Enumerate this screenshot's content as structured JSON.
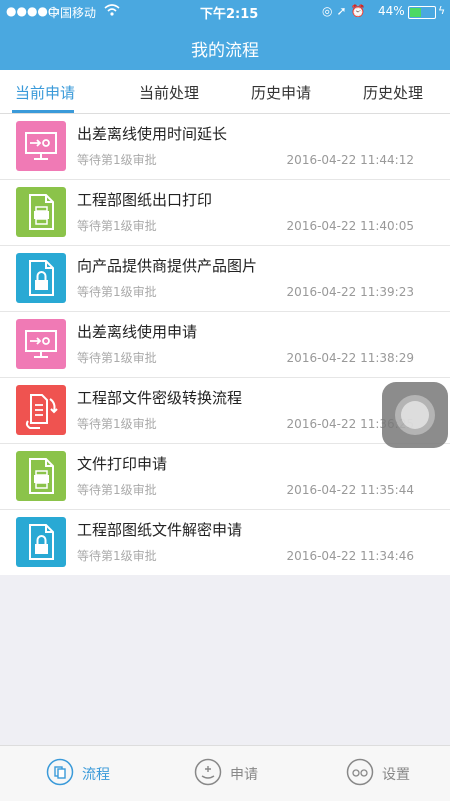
{
  "status_bar": {
    "carrier": "中国移动",
    "time": "下午2:15",
    "battery": "44%",
    "battery_level": 0.44
  },
  "header": {
    "title": "我的流程"
  },
  "tabs": [
    {
      "label": "当前申请",
      "active": true
    },
    {
      "label": "当前处理",
      "active": false
    },
    {
      "label": "历史申请",
      "active": false
    },
    {
      "label": "历史处理",
      "active": false
    }
  ],
  "items": [
    {
      "title": "出差离线使用时间延长",
      "status": "等待第1级审批",
      "date": "2016-04-22 11:44:12",
      "icon": "monitor-icon",
      "color": "#f07ab5"
    },
    {
      "title": "工程部图纸出口打印",
      "status": "等待第1级审批",
      "date": "2016-04-22 11:40:05",
      "icon": "print-document-icon",
      "color": "#8bc34a"
    },
    {
      "title": "向产品提供商提供产品图片",
      "status": "等待第1级审批",
      "date": "2016-04-22 11:39:23",
      "icon": "lock-document-icon",
      "color": "#29a9d4"
    },
    {
      "title": "出差离线使用申请",
      "status": "等待第1级审批",
      "date": "2016-04-22 11:38:29",
      "icon": "monitor-icon",
      "color": "#f07ab5"
    },
    {
      "title": "工程部文件密级转换流程",
      "status": "等待第1级审批",
      "date": "2016-04-22 11:36:25",
      "icon": "convert-document-icon",
      "color": "#ef5350"
    },
    {
      "title": "文件打印申请",
      "status": "等待第1级审批",
      "date": "2016-04-22 11:35:44",
      "icon": "print-document-icon",
      "color": "#8bc34a"
    },
    {
      "title": "工程部图纸文件解密申请",
      "status": "等待第1级审批",
      "date": "2016-04-22 11:34:46",
      "icon": "lock-document-icon",
      "color": "#29a9d4"
    }
  ],
  "bottom_nav": [
    {
      "label": "流程",
      "icon": "flow-icon",
      "active": true
    },
    {
      "label": "申请",
      "icon": "apply-icon",
      "active": false
    },
    {
      "label": "设置",
      "icon": "settings-icon",
      "active": false
    }
  ]
}
